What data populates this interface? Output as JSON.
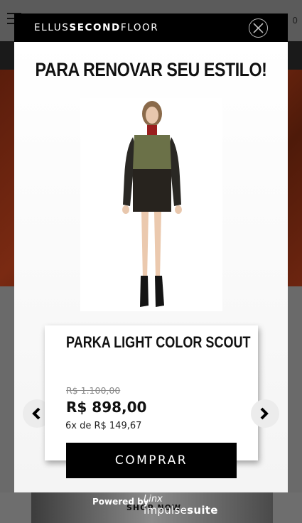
{
  "background": {
    "cart_count": "0",
    "shop_now_label": "SHOP NOW"
  },
  "modal": {
    "brand_parts": [
      "E",
      "LLUS",
      "SECOND",
      "FLOOR"
    ],
    "close_icon": "close-icon",
    "title": "PARA RENOVAR SEU ESTILO!",
    "product": {
      "name": "PARKA LIGHT COLOR SCOUT",
      "old_price": "R$ 1.100,00",
      "price": "R$ 898,00",
      "installments": "6x de R$ 149,67",
      "buy_label": "COMPRAR"
    },
    "nav": {
      "prev_icon": "chevron-left-icon",
      "next_icon": "chevron-right-icon"
    }
  },
  "powered": {
    "by": "Powered by",
    "linx": "Linx",
    "suite_a": "impulse",
    "suite_b": "suite"
  }
}
